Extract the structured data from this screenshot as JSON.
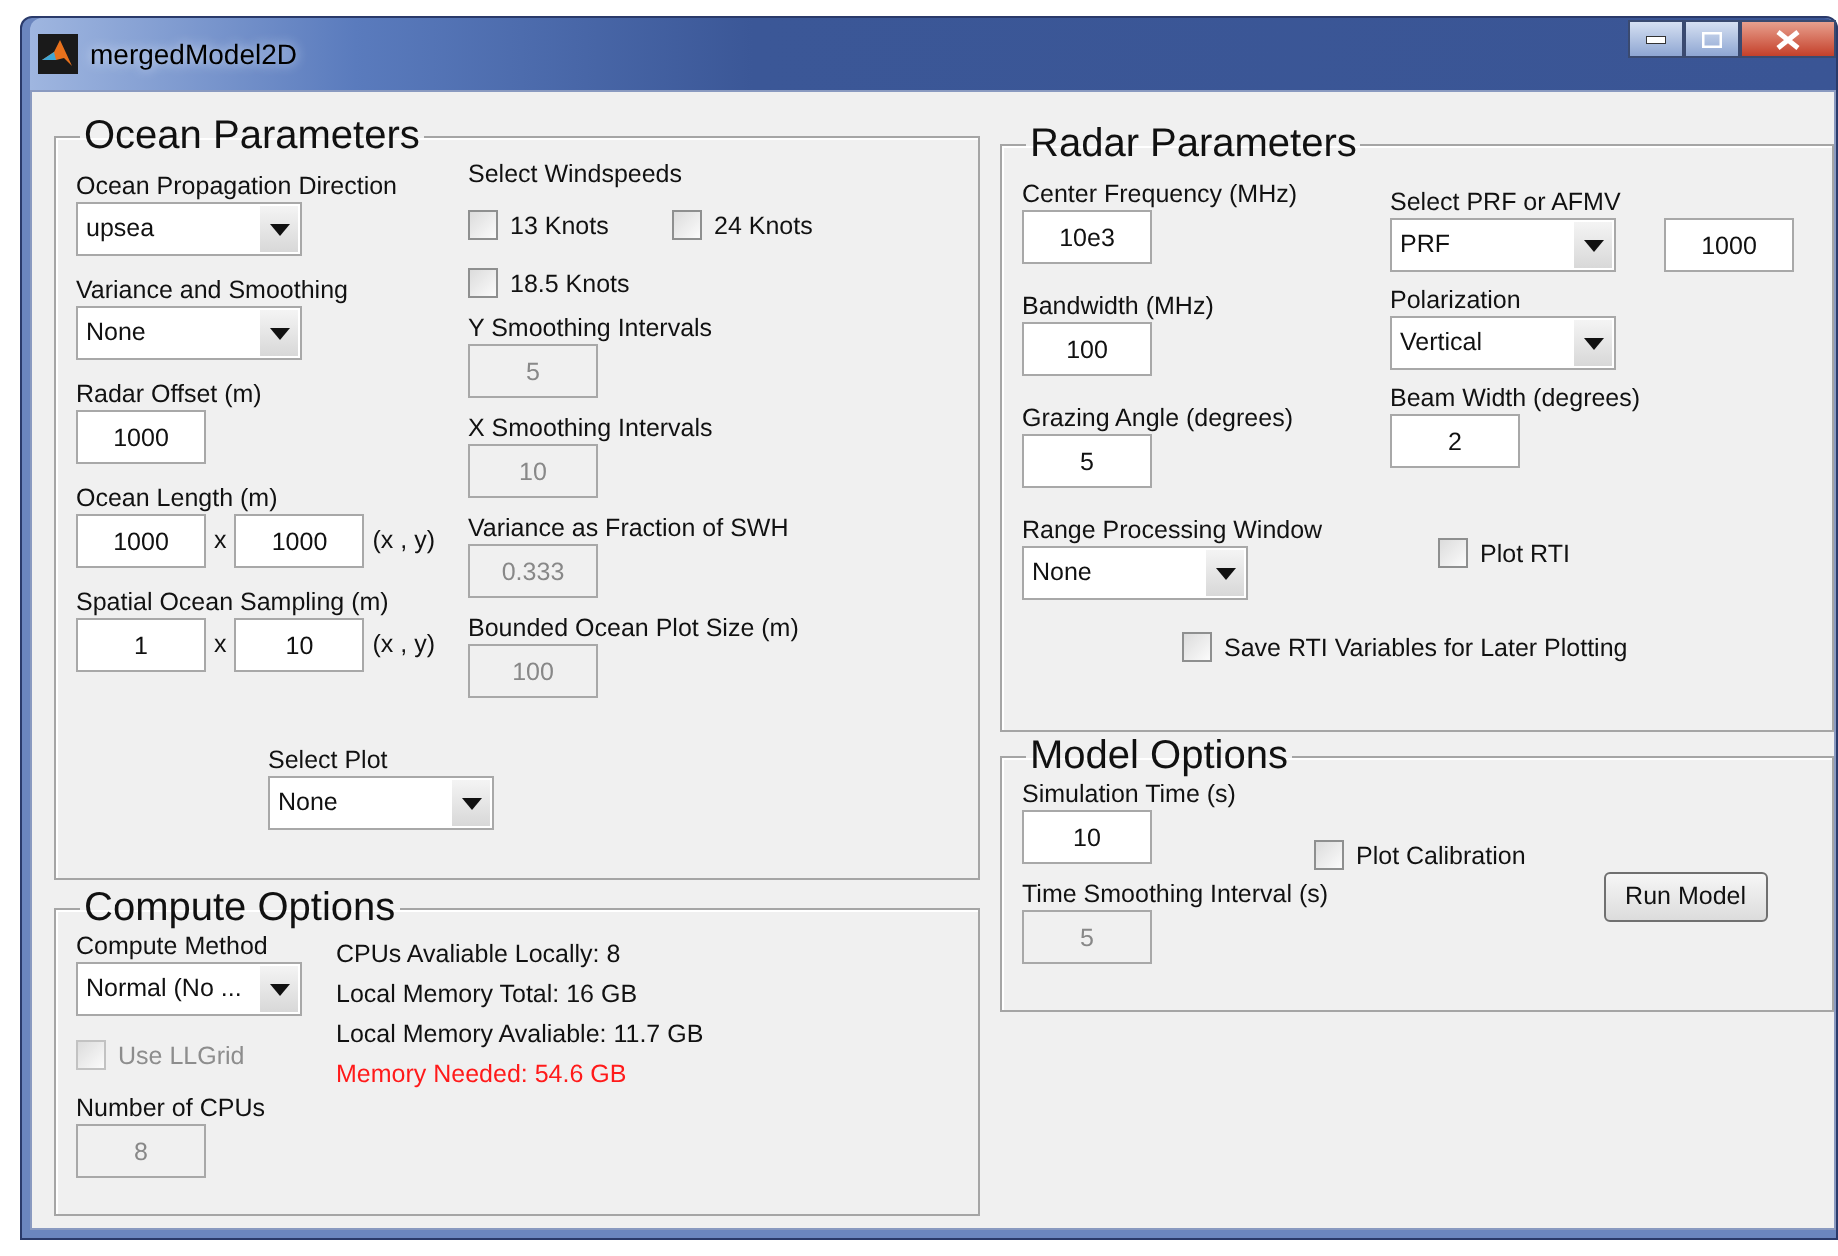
{
  "window": {
    "title": "mergedModel2D"
  },
  "panels": [
    {
      "kind": "ocean",
      "title": "Ocean Parameters",
      "columns": [
        [
          {
            "kind": "dropdown",
            "label": "Ocean Propagation Direction",
            "value": "upsea"
          },
          {
            "kind": "dropdown",
            "label": "Variance and Smoothing",
            "value": "None"
          },
          {
            "kind": "field",
            "label": "Radar Offset (m)",
            "value": "1000",
            "disabled": false
          },
          {
            "kind": "pair",
            "label": "Ocean Length (m)",
            "values": [
              "1000",
              "1000"
            ],
            "separator": "x",
            "unit": "(x , y)"
          },
          {
            "kind": "pair",
            "label": "Spatial Ocean Sampling (m)",
            "values": [
              "1",
              "10"
            ],
            "separator": "x",
            "unit": "(x , y)"
          }
        ],
        [
          {
            "kind": "checkgroup",
            "label": "Select Windspeeds",
            "options": [
              {
                "label": "13 Knots",
                "checked": false
              },
              {
                "label": "24 Knots",
                "checked": false
              },
              {
                "label": "18.5 Knots",
                "checked": false
              }
            ]
          },
          {
            "kind": "field",
            "label": "Y Smoothing Intervals",
            "value": "5",
            "disabled": true
          },
          {
            "kind": "field",
            "label": "X Smoothing Intervals",
            "value": "10",
            "disabled": true
          },
          {
            "kind": "field",
            "label": "Variance as Fraction of SWH",
            "value": "0.333",
            "disabled": true
          },
          {
            "kind": "field",
            "label": "Bounded Ocean Plot Size (m)",
            "value": "100",
            "disabled": true
          }
        ]
      ],
      "footer": [
        {
          "kind": "dropdown",
          "label": "Select Plot",
          "value": "None"
        }
      ]
    },
    {
      "kind": "compute",
      "title": "Compute Options",
      "columns": [
        [
          {
            "kind": "dropdown",
            "label": "Compute Method",
            "value": "Normal (No ..."
          },
          {
            "kind": "checkbox",
            "label": "Use LLGrid",
            "checked": false,
            "disabled": true
          },
          {
            "kind": "field",
            "label": "Number of CPUs",
            "value": "8",
            "disabled": true
          }
        ],
        [
          {
            "kind": "text",
            "text": "CPUs Avaliable Locally: 8",
            "warning": false
          },
          {
            "kind": "text",
            "text": "Local Memory Total: 16 GB",
            "warning": false
          },
          {
            "kind": "text",
            "text": "Local Memory Avaliable: 11.7 GB",
            "warning": false
          },
          {
            "kind": "text",
            "text": "Memory Needed: 54.6 GB",
            "warning": true
          }
        ]
      ]
    },
    {
      "kind": "radar",
      "title": "Radar Parameters",
      "columns": [
        [
          {
            "kind": "field",
            "label": "Center Frequency (MHz)",
            "value": "10e3",
            "disabled": false
          },
          {
            "kind": "field",
            "label": "Bandwidth (MHz)",
            "value": "100",
            "disabled": false
          },
          {
            "kind": "field",
            "label": "Grazing Angle (degrees)",
            "value": "5",
            "disabled": false
          },
          {
            "kind": "dropdown",
            "label": "Range Processing Window",
            "value": "None"
          }
        ],
        [
          {
            "kind": "dropdown_field",
            "label": "Select PRF or AFMV",
            "value": "PRF",
            "field_value": "1000"
          },
          {
            "kind": "dropdown",
            "label": "Polarization",
            "value": "Vertical"
          },
          {
            "kind": "field",
            "label": "Beam Width (degrees)",
            "value": "2",
            "disabled": false
          },
          {
            "kind": "checkbox",
            "label": "Plot RTI",
            "checked": false,
            "disabled": false
          }
        ]
      ],
      "footer": [
        {
          "kind": "checkbox",
          "label": "Save RTI Variables for Later Plotting",
          "checked": false,
          "disabled": false
        }
      ]
    },
    {
      "kind": "model",
      "title": "Model Options",
      "columns": [
        [
          {
            "kind": "field",
            "label": "Simulation Time (s)",
            "value": "10",
            "disabled": false
          },
          {
            "kind": "field",
            "label": "Time Smoothing Interval (s)",
            "value": "5",
            "disabled": true
          }
        ],
        [
          {
            "kind": "checkbox",
            "label": "Plot Calibration",
            "checked": false,
            "disabled": false
          }
        ],
        [
          {
            "kind": "button",
            "label": "Run Model"
          }
        ]
      ]
    }
  ]
}
